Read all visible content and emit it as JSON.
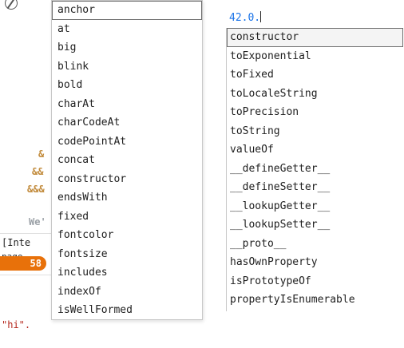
{
  "left": {
    "autocomplete": [
      "anchor",
      "at",
      "big",
      "blink",
      "bold",
      "charAt",
      "charCodeAt",
      "codePointAt",
      "concat",
      "constructor",
      "endsWith",
      "fixed",
      "fontcolor",
      "fontsize",
      "includes",
      "indexOf",
      "isWellFormed"
    ],
    "bg_amp1": "&",
    "bg_amp2": "&&",
    "bg_amp3": "&&&",
    "bg_we": "We'",
    "bg_inte": "[Inte",
    "bg_page": "page",
    "badge_count": "58",
    "bg_hi": "\"hi\"."
  },
  "right": {
    "expression": "42.0.",
    "autocomplete": [
      "constructor",
      "toExponential",
      "toFixed",
      "toLocaleString",
      "toPrecision",
      "toString",
      "valueOf",
      "__defineGetter__",
      "__defineSetter__",
      "__lookupGetter__",
      "__lookupSetter__",
      "__proto__",
      "hasOwnProperty",
      "isPrototypeOf",
      "propertyIsEnumerable"
    ]
  },
  "colors": {
    "badge": "#e8710a",
    "expression": "#1a73e8",
    "amp": "#c28b3c"
  }
}
